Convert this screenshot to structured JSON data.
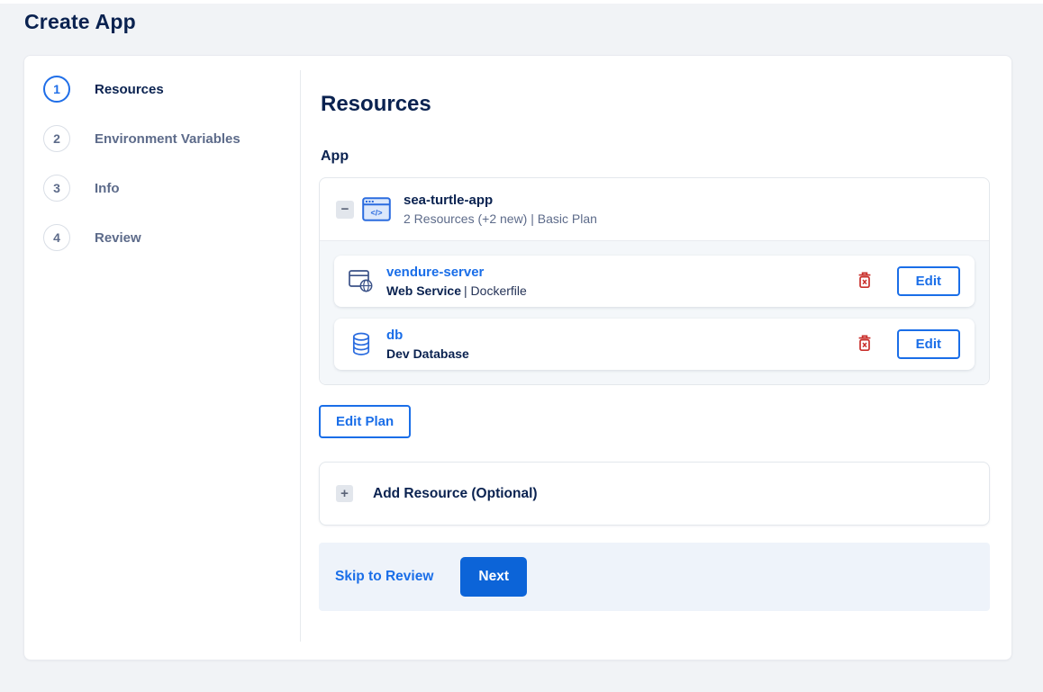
{
  "page": {
    "title": "Create App"
  },
  "icons": {
    "minus_glyph": "−",
    "plus_glyph": "+"
  },
  "stepper": {
    "steps": [
      {
        "number": "1",
        "label": "Resources",
        "active": true
      },
      {
        "number": "2",
        "label": "Environment Variables",
        "active": false
      },
      {
        "number": "3",
        "label": "Info",
        "active": false
      },
      {
        "number": "4",
        "label": "Review",
        "active": false
      }
    ]
  },
  "main": {
    "heading": "Resources",
    "section_label": "App",
    "app_card": {
      "collapse_icon": "minus-icon",
      "app_icon": "app-code-window-icon",
      "name": "sea-turtle-app",
      "subtitle": "2 Resources (+2 new) | Basic Plan",
      "resources": [
        {
          "icon": "web-service-icon",
          "name": "vendure-server",
          "type": "Web Service",
          "detail": "| Dockerfile",
          "delete_icon": "trash-icon",
          "edit_label": "Edit"
        },
        {
          "icon": "database-icon",
          "name": "db",
          "type": "Dev Database",
          "detail": "",
          "delete_icon": "trash-icon",
          "edit_label": "Edit"
        }
      ]
    },
    "edit_plan_label": "Edit Plan",
    "add_resource": {
      "icon": "plus-icon",
      "label": "Add Resource (Optional)"
    },
    "footer": {
      "skip_label": "Skip to Review",
      "next_label": "Next"
    }
  },
  "colors": {
    "accent_blue": "#1a6ee8",
    "primary_button_blue": "#0c64d8",
    "navy_text": "#0a2250",
    "muted_text": "#5d6b8a",
    "danger_red": "#c9302c",
    "footer_bg": "#eef3fa",
    "page_bg": "#f1f3f6"
  }
}
